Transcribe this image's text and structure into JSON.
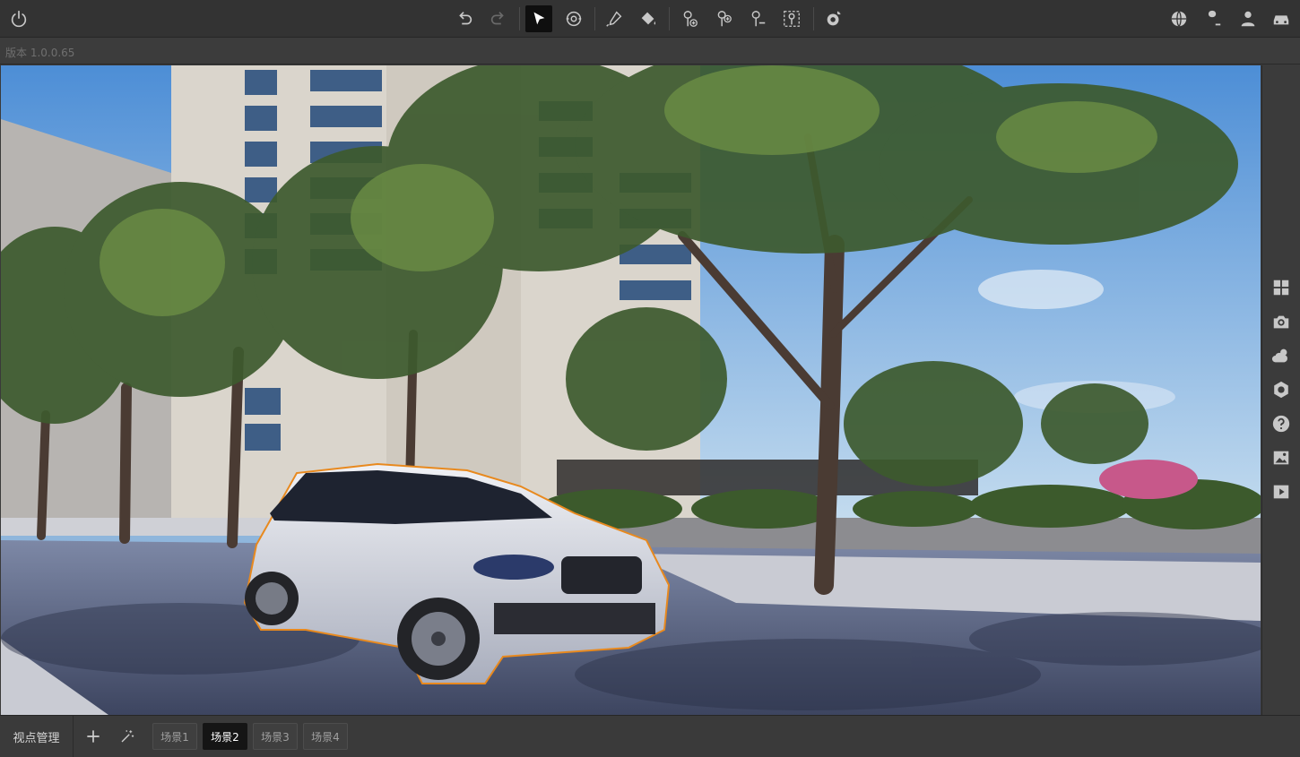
{
  "toolbar": {
    "left_icons": [
      "power-icon"
    ],
    "center_icons": [
      "undo-icon",
      "redo-icon",
      "select-arrow-icon",
      "orbit-view-icon",
      "eyedropper-icon",
      "paint-bucket-icon",
      "add-tree-icon",
      "add-plant-icon",
      "remove-plant-icon",
      "plant-scatter-icon",
      "weather-time-icon"
    ],
    "right_icons": [
      "globe-icon",
      "tree-library-icon",
      "character-icon",
      "car-icon"
    ]
  },
  "version": "版本 1.0.0.65",
  "right_panel": {
    "icons": [
      "grid-icon",
      "camera-icon",
      "weather-icon",
      "settings-icon",
      "help-icon",
      "image-icon",
      "play-icon"
    ]
  },
  "bottom": {
    "viewpoint_label": "视点管理",
    "add_icon": "plus-icon",
    "magic_icon": "magic-wand-icon",
    "scenes": [
      "场景1",
      "场景2",
      "场景3",
      "场景4"
    ],
    "selected_scene": "场景2"
  },
  "colors": {
    "selection_outline": "#e8891e",
    "toolbar_bg": "#333333",
    "active_tool_bg": "#0f0f0f"
  }
}
